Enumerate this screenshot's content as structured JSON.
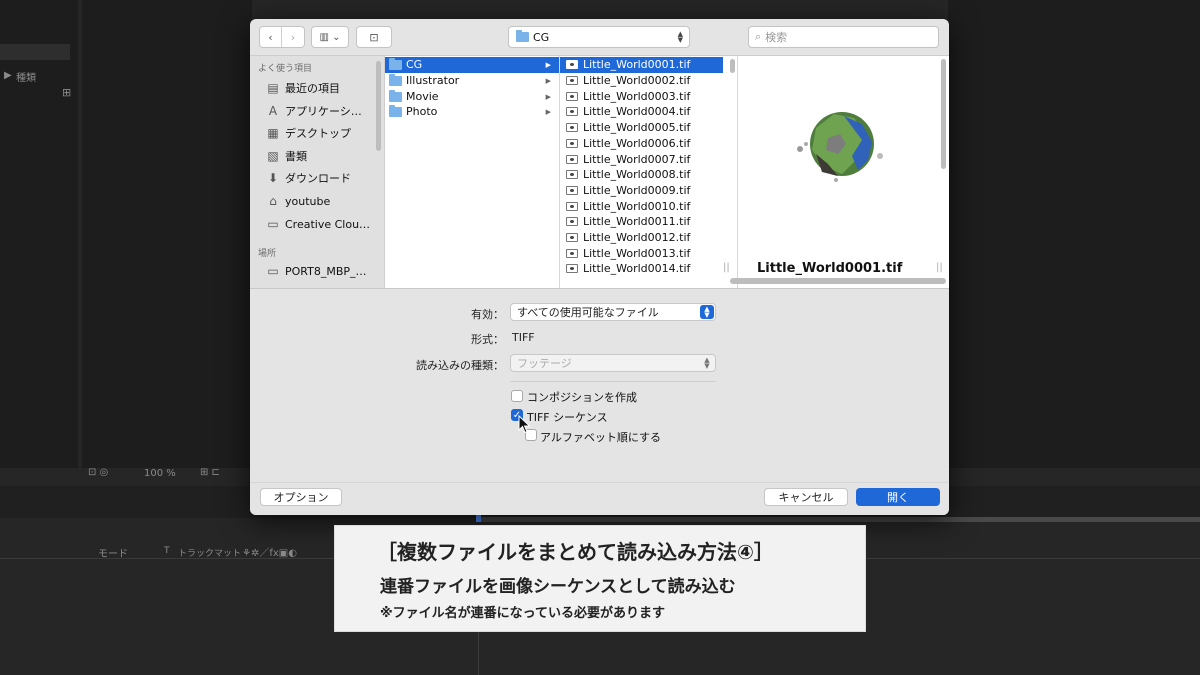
{
  "background": {
    "panel_label": "種類",
    "zoom": "100 %",
    "timeline_mode": "モード",
    "timeline_t": "T",
    "timeline_trackmatte": "トラックマット"
  },
  "toolbar": {
    "folder_name": "CG",
    "search_placeholder": "検索"
  },
  "sidebar": {
    "favorites_header": "よく使う項目",
    "items": [
      {
        "label": "最近の項目",
        "icon": "recents-icon"
      },
      {
        "label": "アプリケーシ…",
        "icon": "applications-icon"
      },
      {
        "label": "デスクトップ",
        "icon": "desktop-icon"
      },
      {
        "label": "書類",
        "icon": "documents-icon"
      },
      {
        "label": "ダウンロード",
        "icon": "downloads-icon"
      },
      {
        "label": "youtube",
        "icon": "home-icon"
      },
      {
        "label": "Creative Clou…",
        "icon": "folder-icon"
      }
    ],
    "locations_header": "場所",
    "locations": [
      {
        "label": "PORT8_MBP_…",
        "icon": "computer-icon"
      }
    ]
  },
  "folders": [
    "CG",
    "Illustrator",
    "Movie",
    "Photo"
  ],
  "files": [
    "Little_World0001.tif",
    "Little_World0002.tif",
    "Little_World0003.tif",
    "Little_World0004.tif",
    "Little_World0005.tif",
    "Little_World0006.tif",
    "Little_World0007.tif",
    "Little_World0008.tif",
    "Little_World0009.tif",
    "Little_World0010.tif",
    "Little_World0011.tif",
    "Little_World0012.tif",
    "Little_World0013.tif",
    "Little_World0014.tif"
  ],
  "preview": {
    "filename": "Little_World0001.tif"
  },
  "form": {
    "enable_label": "有効：",
    "enable_value": "すべての使用可能なファイル",
    "format_label": "形式：",
    "format_value": "TIFF",
    "import_as_label": "読み込みの種類：",
    "import_as_value": "フッテージ",
    "create_composition": "コンポジションを作成",
    "tiff_sequence": "TIFF シーケンス",
    "alphabetical": "アルファベット順にする"
  },
  "buttons": {
    "options": "オプション",
    "cancel": "キャンセル",
    "open": "開く"
  },
  "caption": {
    "title": "［複数ファイルをまとめて読み込み方法④］",
    "subtitle": "連番ファイルを画像シーケンスとして読み込む",
    "note": "※ファイル名が連番になっている必要があります"
  },
  "colors": {
    "accent": "#1f68d8",
    "dialog_bg": "#e4e4e4",
    "app_bg": "#262626"
  }
}
